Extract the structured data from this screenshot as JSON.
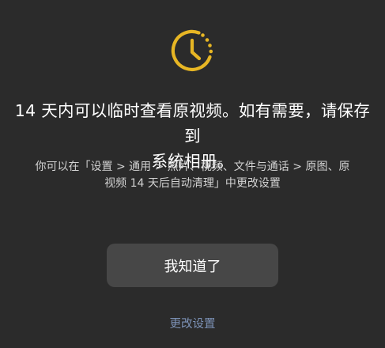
{
  "dialog": {
    "icon": "clock-icon",
    "accent_color": "#e7b624",
    "title_line1": "14 天内可以临时查看原视频。如有需要，请保存到",
    "title_line2": "系统相册。",
    "desc_line1": "你可以在「设置 > 通用 > 照片、视频、文件与通话 > 原图、原",
    "desc_line2": "视频 14 天后自动清理」中更改设置",
    "primary_button_label": "我知道了",
    "secondary_link_label": "更改设置",
    "link_color": "#7d93b8"
  }
}
